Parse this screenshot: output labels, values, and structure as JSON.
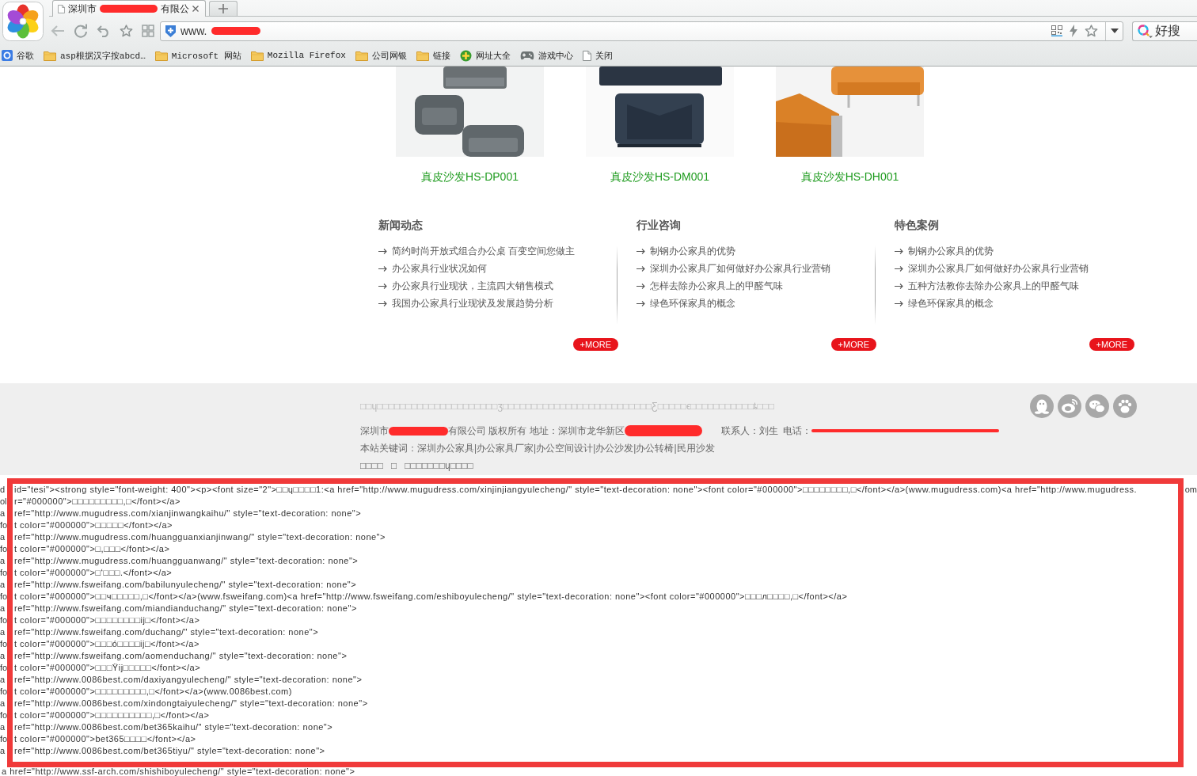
{
  "browser": {
    "tabs": [
      {
        "title": [
          {
            "kind": "text",
            "text": "深圳市"
          },
          {
            "kind": "redaction"
          },
          {
            "kind": "text",
            "text": "有限公"
          }
        ],
        "selected": true
      }
    ],
    "address": [
      {
        "kind": "text",
        "text": "www."
      },
      {
        "kind": "redaction"
      }
    ],
    "search": {
      "engine_label": "好搜"
    },
    "bookmarks": [
      {
        "kind": "tile",
        "label": "谷歌"
      },
      {
        "kind": "folder",
        "label": "asp根据汉字按abcd…"
      },
      {
        "kind": "folder",
        "label": "Microsoft 网站"
      },
      {
        "kind": "folder",
        "label": "Mozilla Firefox"
      },
      {
        "kind": "folder",
        "label": "公司网银"
      },
      {
        "kind": "folder",
        "label": "链接"
      },
      {
        "kind": "plus",
        "label": "网址大全"
      },
      {
        "kind": "gamepad",
        "label": "游戏中心"
      },
      {
        "kind": "page",
        "label": "关闭"
      }
    ]
  },
  "products": [
    {
      "kind": "trio",
      "name": "真皮沙发HS-DP001"
    },
    {
      "kind": "pair",
      "name": "真皮沙发HS-DM001"
    },
    {
      "kind": "angle",
      "name": "真皮沙发HS-DH001"
    }
  ],
  "columns": [
    {
      "title": "新闻动态",
      "items": [
        "简约时尚开放式组合办公桌 百变空间您做主",
        "办公家具行业状况如何",
        "办公家具行业现状，主流四大销售模式",
        "我国办公家具行业现状及发展趋势分析"
      ],
      "more": "+MORE"
    },
    {
      "title": "行业咨询",
      "items": [
        "制钢办公家具的优势",
        "深圳办公家具厂如何做好办公家具行业营销",
        "怎样去除办公家具上的甲醛气味",
        "绿色环保家具的概念"
      ],
      "more": "+MORE"
    },
    {
      "title": "特色案例",
      "items": [
        "制钢办公家具的优势",
        "深圳办公家具厂如何做好办公家具行业营销",
        "五种方法教你去除办公家具上的甲醛气味",
        "绿色环保家具的概念"
      ],
      "more": "+MORE"
    }
  ],
  "footer": {
    "notice": "□□ɥ□□□□□□□□□□□□□□□□□□□□□ʒ□□□□□□□□□□□□□□□□□□□□□□□□□□Ƹ□□□□□ϵ□□□□□□□□□□□ȶ□□□",
    "copyright": [
      {
        "kind": "text",
        "text": "深圳市"
      },
      {
        "kind": "redaction"
      },
      {
        "kind": "text",
        "text": "有限公司 版权所有 地址：深圳市龙华新区"
      },
      {
        "kind": "redaction"
      },
      {
        "kind": "text",
        "text": "联系人：刘生  电话："
      },
      {
        "kind": "redaction"
      }
    ],
    "keywords": "本站关键词：深圳办公家具|办公家具厂家|办公空间设计|办公沙发|办公转椅|民用沙发",
    "extra": "□□□□   □   □□□□□□□ɥ□□□□",
    "social": [
      {
        "kind": "penguin"
      },
      {
        "kind": "eye"
      },
      {
        "kind": "bubbles"
      },
      {
        "kind": "paw"
      }
    ]
  },
  "code_listing": {
    "framed": true,
    "lines": [
      {
        "cut": "d",
        "text": "id=\"tesi\"><strong style=\"font-weight: 400\"><p><font size=\"2\">□□ɥ□□□□1:<a href=\"http://www.mugudress.com/xinjinjiangyulecheng/\" style=\"text-decoration: none\"><font color=\"#000000\">□□□□□□□□,□</font></a>(www.mugudress.com)<a href=\"http://www.mugudress.",
        "cut_right": "om"
      },
      {
        "cut": "ol",
        "text": "r=\"#000000\">□□□□□□□□□,□</font></a>"
      },
      {
        "cut": "a",
        "text": "ref=\"http://www.mugudress.com/xianjinwangkaihu/\" style=\"text-decoration: none\">"
      },
      {
        "cut": "fo",
        "text": "t color=\"#000000\">□□□□□</font></a>"
      },
      {
        "cut": "a",
        "text": "ref=\"http://www.mugudress.com/huangguanxianjinwang/\" style=\"text-decoration: none\">"
      },
      {
        "cut": "fo",
        "text": "t color=\"#000000\">□,□□□</font></a>"
      },
      {
        "cut": "a",
        "text": "ref=\"http://www.mugudress.com/huangguanwang/\" style=\"text-decoration: none\">"
      },
      {
        "cut": "fo",
        "text": "t color=\"#000000\">□ʻ□□□.</font></a>"
      },
      {
        "cut": "a",
        "text": "ref=\"http://www.fsweifang.com/babilunyulecheng/\" style=\"text-decoration: none\">"
      },
      {
        "cut": "fo",
        "text": "t color=\"#000000\">□□ч□□□□□,□</font></a>(www.fsweifang.com)<a href=\"http://www.fsweifang.com/eshiboyulecheng/\" style=\"text-decoration: none\"><font color=\"#000000\">□□□л□□□□,□</font></a>"
      },
      {
        "cut": "a",
        "text": "ref=\"http://www.fsweifang.com/miandianduchang/\" style=\"text-decoration: none\">"
      },
      {
        "cut": "fo",
        "text": "t color=\"#000000\">□□□□□□□□ij□</font></a>"
      },
      {
        "cut": "a",
        "text": "ref=\"http://www.fsweifang.com/duchang/\" style=\"text-decoration: none\">"
      },
      {
        "cut": "fo",
        "text": "t color=\"#000000\">□□□ó□□□□ij□</font></a>"
      },
      {
        "cut": "a",
        "text": "ref=\"http://www.fsweifang.com/aomenduchang/\" style=\"text-decoration: none\">"
      },
      {
        "cut": "fo",
        "text": "t color=\"#000000\">□□□Ÿij□□□□□</font></a>"
      },
      {
        "cut": "a",
        "text": "ref=\"http://www.0086best.com/daxiyangyulecheng/\" style=\"text-decoration: none\">"
      },
      {
        "cut": "fo",
        "text": "t color=\"#000000\">□□□□□□□□□,□</font></a>(www.0086best.com)"
      },
      {
        "cut": "a",
        "text": "ref=\"http://www.0086best.com/xindongtaiyulecheng/\" style=\"text-decoration: none\">"
      },
      {
        "cut": "fo",
        "text": "t color=\"#000000\">□□□□□□□□□□,□</font></a>"
      },
      {
        "cut": "a",
        "text": "ref=\"http://www.0086best.com/bet365kaihu/\" style=\"text-decoration: none\">"
      },
      {
        "cut": "fo",
        "text": "t color=\"#000000\">bet365□□□□</font></a>"
      },
      {
        "cut": "a",
        "text": "ref=\"http://www.0086best.com/bet365tiyu/\" style=\"text-decoration: none\">"
      }
    ],
    "after_frame": "a href=\"http://www.ssf-arch.com/shishiboyulecheng/\" style=\"text-decoration: none\">"
  }
}
